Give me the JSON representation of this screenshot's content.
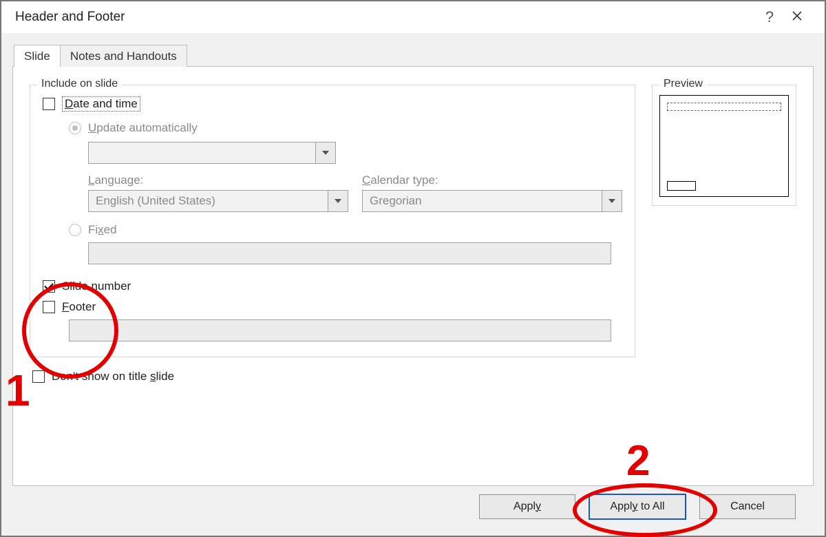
{
  "titlebar": {
    "title": "Header and Footer"
  },
  "tabs": {
    "slide": "Slide",
    "notes": "Notes and Handouts"
  },
  "group_include": {
    "legend": "Include on slide",
    "date_time": "Date and time",
    "update_auto": "Update automatically",
    "date_format_value": "",
    "language_label": "Language:",
    "language_value": "English (United States)",
    "calendar_label": "Calendar type:",
    "calendar_value": "Gregorian",
    "fixed": "Fixed",
    "fixed_value": "",
    "slide_number": "Slide number",
    "footer": "Footer",
    "footer_value": ""
  },
  "dont_show": "Don't show on title slide",
  "preview_label": "Preview",
  "buttons": {
    "apply": "Apply",
    "apply_all": "Apply to All",
    "cancel": "Cancel"
  },
  "annotations": {
    "n1": "1",
    "n2": "2"
  },
  "underline": {
    "date": "D",
    "update": "U",
    "language": "L",
    "calendar": "C",
    "fixed": "x",
    "number": "n",
    "footer": "F",
    "slide": "s",
    "apply": "y",
    "apply_all": "y"
  }
}
